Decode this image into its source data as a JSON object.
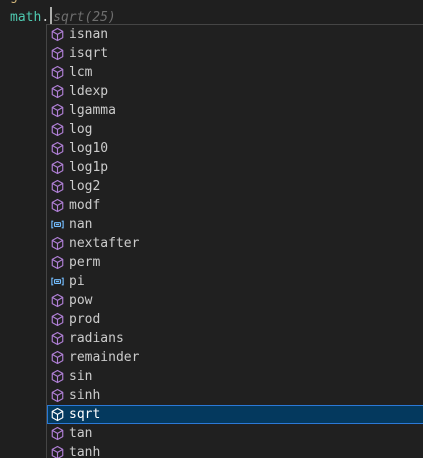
{
  "editor": {
    "prev_line_text": "g",
    "code": {
      "identifier": "math",
      "dot": ".",
      "ghost_text": "sqrt(25)"
    }
  },
  "suggestions": [
    {
      "label": "isnan",
      "icon": "method-icon",
      "selected": false
    },
    {
      "label": "isqrt",
      "icon": "method-icon",
      "selected": false
    },
    {
      "label": "lcm",
      "icon": "method-icon",
      "selected": false
    },
    {
      "label": "ldexp",
      "icon": "method-icon",
      "selected": false
    },
    {
      "label": "lgamma",
      "icon": "method-icon",
      "selected": false
    },
    {
      "label": "log",
      "icon": "method-icon",
      "selected": false
    },
    {
      "label": "log10",
      "icon": "method-icon",
      "selected": false
    },
    {
      "label": "log1p",
      "icon": "method-icon",
      "selected": false
    },
    {
      "label": "log2",
      "icon": "method-icon",
      "selected": false
    },
    {
      "label": "modf",
      "icon": "method-icon",
      "selected": false
    },
    {
      "label": "nan",
      "icon": "variable-icon",
      "selected": false
    },
    {
      "label": "nextafter",
      "icon": "method-icon",
      "selected": false
    },
    {
      "label": "perm",
      "icon": "method-icon",
      "selected": false
    },
    {
      "label": "pi",
      "icon": "variable-icon",
      "selected": false
    },
    {
      "label": "pow",
      "icon": "method-icon",
      "selected": false
    },
    {
      "label": "prod",
      "icon": "method-icon",
      "selected": false
    },
    {
      "label": "radians",
      "icon": "method-icon",
      "selected": false
    },
    {
      "label": "remainder",
      "icon": "method-icon",
      "selected": false
    },
    {
      "label": "sin",
      "icon": "method-icon",
      "selected": false
    },
    {
      "label": "sinh",
      "icon": "method-icon",
      "selected": false
    },
    {
      "label": "sqrt",
      "icon": "method-icon",
      "selected": true
    },
    {
      "label": "tan",
      "icon": "method-icon",
      "selected": false
    },
    {
      "label": "tanh",
      "icon": "method-icon",
      "selected": false
    }
  ],
  "colors": {
    "method_icon": "#b180d7",
    "variable_icon": "#75beff",
    "selected_bg": "#04395e"
  }
}
